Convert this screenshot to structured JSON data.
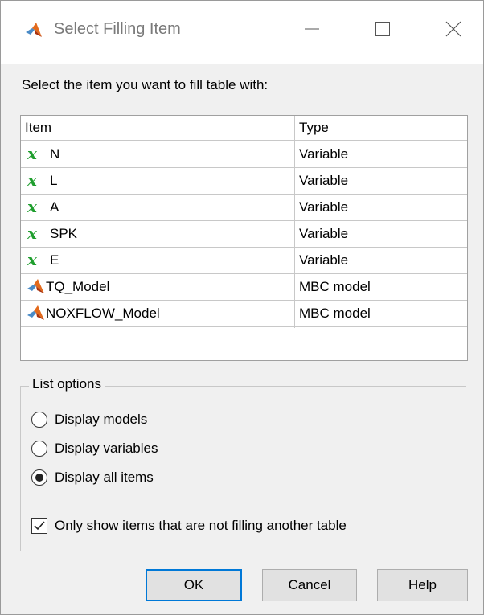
{
  "window": {
    "title": "Select Filling Item",
    "minimize_icon": "minimize-icon",
    "maximize_icon": "maximize-icon",
    "close_icon": "close-icon"
  },
  "prompt": "Select the item you want to fill table with:",
  "table": {
    "headers": {
      "item": "Item",
      "type": "Type"
    },
    "rows": [
      {
        "icon": "variable-icon",
        "name": "N",
        "type": "Variable"
      },
      {
        "icon": "variable-icon",
        "name": "L",
        "type": "Variable"
      },
      {
        "icon": "variable-icon",
        "name": "A",
        "type": "Variable"
      },
      {
        "icon": "variable-icon",
        "name": "SPK",
        "type": "Variable"
      },
      {
        "icon": "variable-icon",
        "name": "E",
        "type": "Variable"
      },
      {
        "icon": "matlab-model-icon",
        "name": "TQ_Model",
        "type": "MBC model"
      },
      {
        "icon": "matlab-model-icon",
        "name": "NOXFLOW_Model",
        "type": "MBC model"
      }
    ],
    "variable_glyph": "x"
  },
  "list_options": {
    "legend": "List options",
    "radios": [
      {
        "label": "Display models",
        "checked": false
      },
      {
        "label": "Display variables",
        "checked": false
      },
      {
        "label": "Display all items",
        "checked": true
      }
    ],
    "checkbox": {
      "label": "Only show items that are not filling another table",
      "checked": true
    }
  },
  "buttons": {
    "ok": "OK",
    "cancel": "Cancel",
    "help": "Help"
  },
  "colors": {
    "variable_green": "#1f9e2e",
    "ok_focus_border": "#0078d7",
    "dialog_bg": "#f0f0f0"
  }
}
